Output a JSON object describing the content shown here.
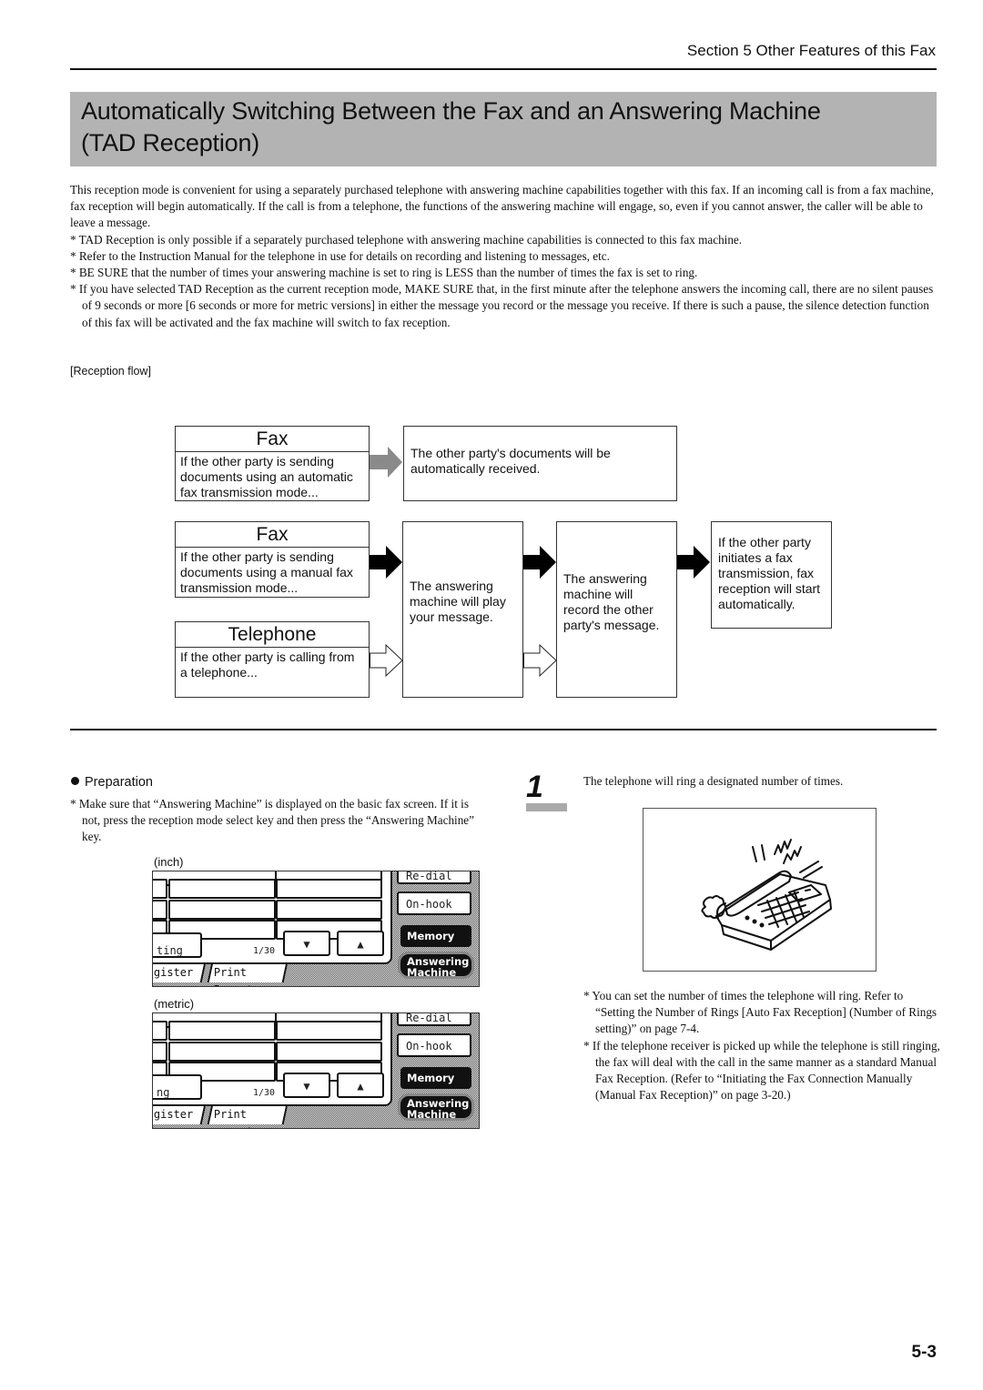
{
  "header": {
    "section": "Section 5  Other Features of this Fax"
  },
  "title": {
    "line1": "Automatically Switching Between the Fax and an Answering Machine",
    "line2": "(TAD Reception)"
  },
  "intro": {
    "paragraph": "This reception mode is convenient for using a separately purchased telephone with answering machine capabilities together with this fax. If an incoming call is from a fax machine, fax reception will begin automatically. If the call is from a telephone, the functions of the answering machine will engage, so, even if you cannot answer, the caller will be able to leave a message.",
    "notes": [
      "* TAD Reception is only possible if a separately purchased telephone with answering machine capabilities is connected to this fax machine.",
      "* Refer to the Instruction Manual for the telephone in use for details on recording and listening to messages, etc.",
      "* BE SURE that the number of times your answering machine is set to ring is LESS than the number of times the fax is set to ring.",
      "* If you have selected TAD Reception as the current reception mode, MAKE SURE that, in the first minute after the telephone answers the incoming call, there are no silent pauses of 9 seconds or more [6 seconds or more for metric versions] in either the message you record or the message you receive. If there is such a pause, the silence detection function of this fax will be activated and the fax machine will switch to fax reception."
    ]
  },
  "flow": {
    "label": "[Reception flow]",
    "fax_auto": {
      "header": "Fax",
      "body": "If the other party is sending documents using an automatic fax transmission mode..."
    },
    "auto_result": "The other party's documents will be automatically received.",
    "fax_manual": {
      "header": "Fax",
      "body": "If the other party is sending documents using a manual fax transmission mode..."
    },
    "telephone": {
      "header": "Telephone",
      "body": "If the other party is calling from a telephone..."
    },
    "play_message": "The answering machine will play your message.",
    "record_message": "The answering machine will record the other party's message.",
    "fax_start": "If the other party initiates a fax transmission, fax reception will start automatically."
  },
  "preparation": {
    "title": "Preparation",
    "text": "* Make sure that “Answering Machine” is displayed on the basic fax screen. If it is not, press the reception mode select key and then press the “Answering Machine” key.",
    "panels": [
      {
        "caption": "(inch)",
        "redial": "Re-dial",
        "onhook": "On-hook",
        "memory": "Memory TX",
        "answering1": "Answering",
        "answering2": "Machine",
        "setting": "ting",
        "page": "1/30",
        "tab_register": "gister",
        "tab_report": "Print Report"
      },
      {
        "caption": "(metric)",
        "redial": "Re-dial",
        "onhook": "On-hook",
        "memory": "Memory Tx",
        "answering1": "Answering",
        "answering2": "Machine",
        "setting": "ng",
        "page": "1/30",
        "tab_register": "gister",
        "tab_report": "Print report"
      }
    ]
  },
  "step": {
    "number": "1",
    "text": "The telephone will ring a designated number of times.",
    "notes": [
      "* You can set the number of times the telephone will ring. Refer to “Setting the Number of Rings [Auto Fax Reception] (Number of Rings setting)” on page 7-4.",
      "* If the telephone receiver is picked up while the telephone is still ringing, the fax will deal with the call in the same manner as a standard Manual Fax Reception. (Refer to “Initiating the Fax Connection Manually (Manual Fax Reception)” on page 3-20.)"
    ]
  },
  "footer": {
    "page": "5-3"
  }
}
